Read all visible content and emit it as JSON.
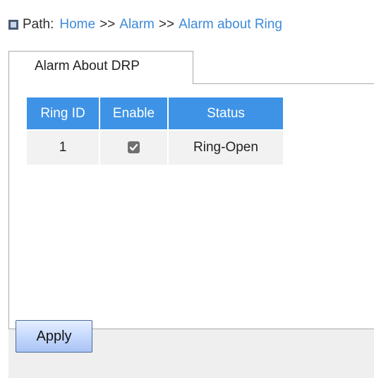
{
  "path": {
    "label": "Path:",
    "crumbs": [
      "Home",
      "Alarm",
      "Alarm about Ring"
    ],
    "separator": ">>"
  },
  "tabs": [
    {
      "label": "Alarm About DRP",
      "selected": true
    }
  ],
  "table": {
    "headers": [
      "Ring ID",
      "Enable",
      "Status"
    ],
    "rows": [
      {
        "ring_id": "1",
        "enable": true,
        "status": "Ring-Open"
      }
    ]
  },
  "footer": {
    "apply_label": "Apply"
  },
  "colors": {
    "header_bg": "#3e93e6",
    "link": "#3d8ad9",
    "row_bg": "#f2f2f2",
    "footer_bg": "#efefef"
  }
}
